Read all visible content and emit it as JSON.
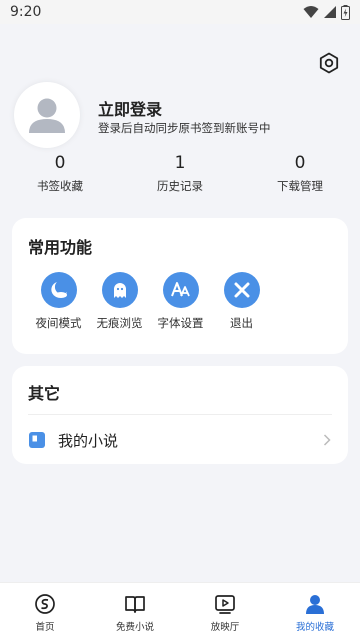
{
  "status_bar": {
    "time": "9:20"
  },
  "profile": {
    "title": "立即登录",
    "subtitle": "登录后自动同步原书签到新账号中"
  },
  "stats": [
    {
      "value": "0",
      "label": "书签收藏"
    },
    {
      "value": "1",
      "label": "历史记录"
    },
    {
      "value": "0",
      "label": "下载管理"
    }
  ],
  "common": {
    "title": "常用功能",
    "items": [
      {
        "label": "夜间模式",
        "icon": "night-mode-icon"
      },
      {
        "label": "无痕浏览",
        "icon": "ghost-icon"
      },
      {
        "label": "字体设置",
        "icon": "font-icon"
      },
      {
        "label": "退出",
        "icon": "close-icon"
      }
    ]
  },
  "other": {
    "title": "其它",
    "items": [
      {
        "label": "我的小说",
        "icon": "book-icon"
      }
    ]
  },
  "bottom_nav": [
    {
      "label": "首页",
      "icon": "home-icon",
      "active": false
    },
    {
      "label": "免费小说",
      "icon": "open-book-icon",
      "active": false
    },
    {
      "label": "放映厅",
      "icon": "play-icon",
      "active": false
    },
    {
      "label": "我的收藏",
      "icon": "user-icon",
      "active": true
    }
  ],
  "colors": {
    "accent": "#2a6fd6",
    "icon_blue": "#4a90e6",
    "background": "#f3f4f8"
  }
}
